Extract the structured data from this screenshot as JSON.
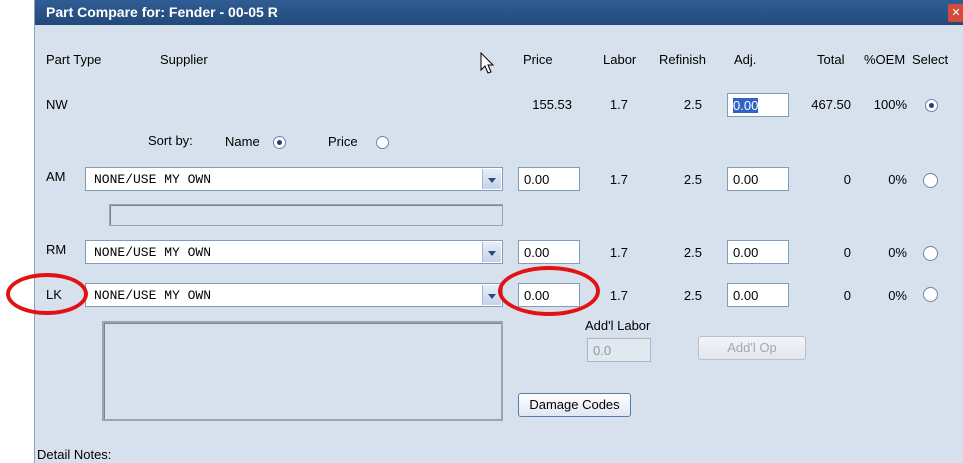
{
  "window": {
    "title": "Part Compare for: Fender - 00-05  R",
    "close_glyph": "✕"
  },
  "headers": {
    "part_type": "Part Type",
    "supplier": "Supplier",
    "price": "Price",
    "labor": "Labor",
    "refinish": "Refinish",
    "adj": "Adj.",
    "total": "Total",
    "oem": "%OEM",
    "select": "Select"
  },
  "rows": {
    "nw": {
      "type": "NW",
      "price": "155.53",
      "labor": "1.7",
      "refinish": "2.5",
      "adj": "0.00",
      "total": "467.50",
      "oem": "100%"
    },
    "sort": {
      "label": "Sort by:",
      "name": "Name",
      "price": "Price",
      "selected": "Name"
    },
    "am": {
      "type": "AM",
      "supplier": "NONE/USE MY OWN",
      "price": "0.00",
      "labor": "1.7",
      "refinish": "2.5",
      "adj": "0.00",
      "total": "0",
      "oem": "0%"
    },
    "rm": {
      "type": "RM",
      "supplier": "NONE/USE MY OWN",
      "price": "0.00",
      "labor": "1.7",
      "refinish": "2.5",
      "adj": "0.00",
      "total": "0",
      "oem": "0%"
    },
    "lk": {
      "type": "LK",
      "supplier": "NONE/USE MY OWN",
      "price": "0.00",
      "labor": "1.7",
      "refinish": "2.5",
      "adj": "0.00",
      "total": "0",
      "oem": "0%"
    }
  },
  "addl_labor": {
    "label": "Add'l Labor",
    "value": "0.0"
  },
  "buttons": {
    "addl_op": "Add'l Op",
    "damage_codes": "Damage Codes"
  },
  "detail_notes": "Detail Notes:",
  "colors": {
    "title_bar": "#2a5388",
    "dialog_bg": "#d7e1ee",
    "annotation": "#e21212"
  }
}
